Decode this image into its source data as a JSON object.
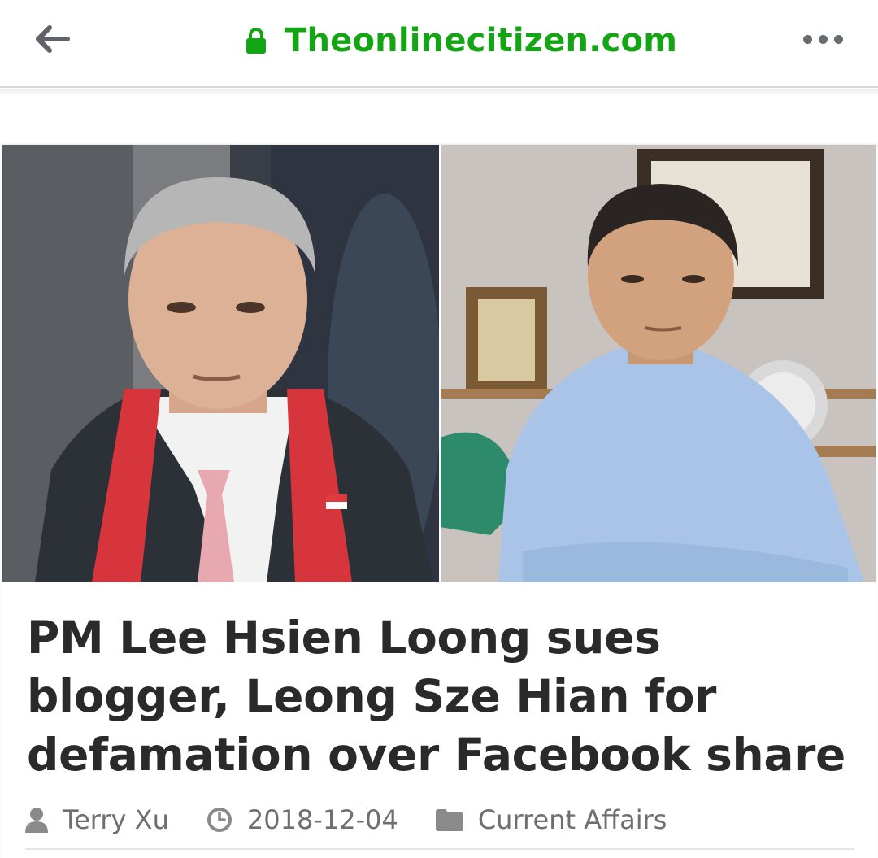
{
  "browser": {
    "url": "Theonlinecitizen.com",
    "back_icon": "arrow-left-icon",
    "secure_icon": "lock-icon",
    "menu_icon": "more-dots-icon",
    "url_color": "#14a514"
  },
  "article": {
    "title": "PM Lee Hsien Loong sues blogger, Leong Sze Hian for defamation over Facebook share",
    "author": "Terry Xu",
    "date": "2018-12-04",
    "category": "Current Affairs",
    "author_icon": "user-icon",
    "date_icon": "clock-icon",
    "category_icon": "folder-icon"
  }
}
